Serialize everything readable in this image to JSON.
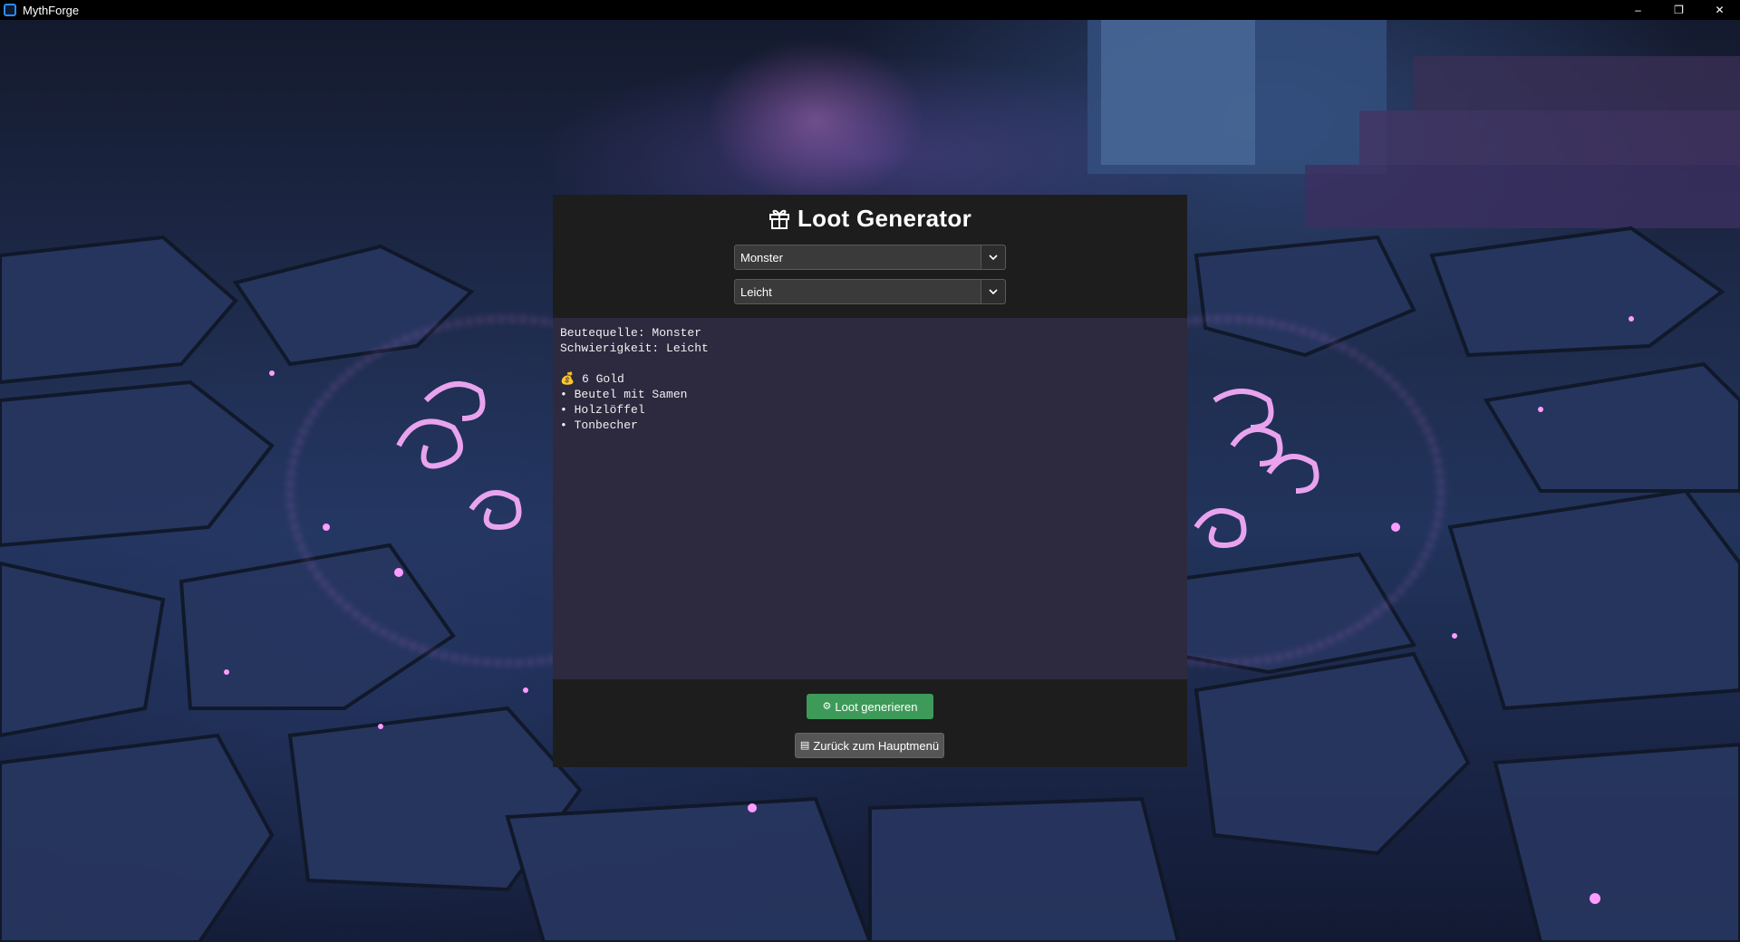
{
  "window": {
    "title": "MythForge",
    "controls": {
      "minimize": "–",
      "maximize": "❐",
      "close": "✕"
    }
  },
  "panel": {
    "title": "Loot Generator",
    "title_icon": "gift-icon",
    "source_select": {
      "value": "Monster",
      "icon": "chevron-down-icon"
    },
    "difficulty_select": {
      "value": "Leicht",
      "icon": "chevron-down-icon"
    },
    "output": {
      "lines": [
        "Beutequelle: Monster",
        "Schwierigkeit: Leicht",
        "",
        "💰 6 Gold",
        "• Beutel mit Samen",
        "• Holzlöffel",
        "• Tonbecher"
      ]
    },
    "generate_button": {
      "icon": "⚙",
      "icon_name": "gear-icon",
      "label": "Loot generieren",
      "color": "#3d9a58"
    },
    "back_button": {
      "icon": "▤",
      "icon_name": "menu-icon",
      "label": "Zurück zum Hauptmenü",
      "color": "#555555"
    }
  },
  "colors": {
    "panel_bg": "#1d1d1d",
    "output_bg": "#2d2a3f",
    "rune_glow": "#ff7bff"
  }
}
